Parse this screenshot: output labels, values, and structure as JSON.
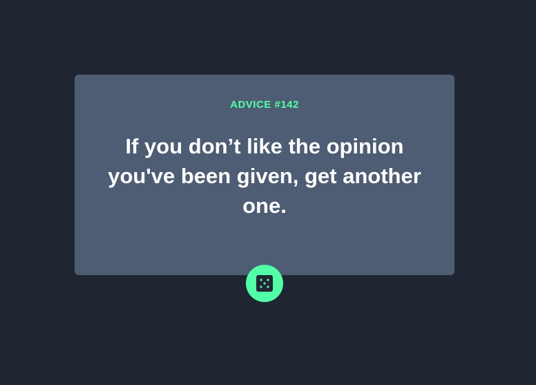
{
  "advice": {
    "label": "ADVICE #142",
    "text": "If you don’t like the opinion you've been given, get another one."
  },
  "dice_button": {
    "icon": "dice-icon"
  },
  "colors": {
    "background": "#1f2632",
    "card": "#4e5d73",
    "accent": "#52ffa8",
    "text": "#ffffff"
  }
}
